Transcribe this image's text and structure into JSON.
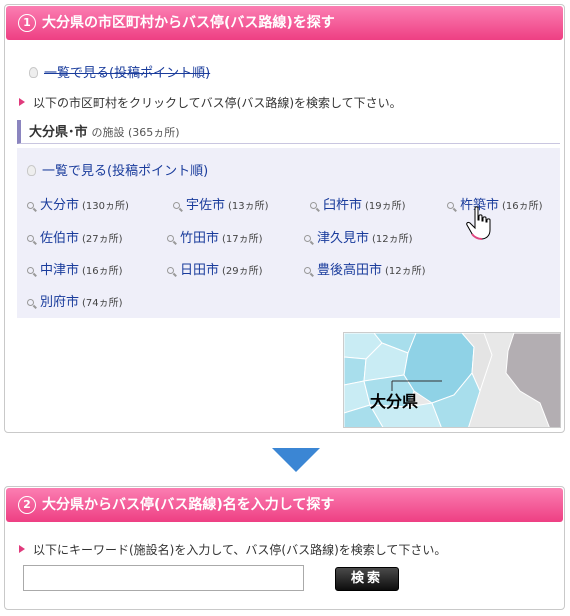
{
  "section1": {
    "number": "1",
    "title": "大分県の市区町村からバス停(バス路線)を探す",
    "list_link_top": "一覧で見る(投稿ポイント順)",
    "instruction": "以下の市区町村をクリックしてバス停(バス路線)を検索して下さい。",
    "prefecture_name": "大分県･市",
    "prefecture_count": "の施設 (365ヵ所)",
    "list_link": "一覧で見る(投稿ポイント順)",
    "cities": [
      {
        "name": "大分市",
        "count": "(130ヵ所)"
      },
      {
        "name": "宇佐市",
        "count": "(13ヵ所)"
      },
      {
        "name": "臼杵市",
        "count": "(19ヵ所)"
      },
      {
        "name": "杵築市",
        "count": "(16ヵ所)"
      },
      {
        "name": "佐伯市",
        "count": "(27ヵ所)"
      },
      {
        "name": "竹田市",
        "count": "(17ヵ所)"
      },
      {
        "name": "津久見市",
        "count": "(12ヵ所)"
      },
      {
        "name": "中津市",
        "count": "(16ヵ所)"
      },
      {
        "name": "日田市",
        "count": "(29ヵ所)"
      },
      {
        "name": "豊後高田市",
        "count": "(12ヵ所)"
      },
      {
        "name": "別府市",
        "count": "(74ヵ所)"
      }
    ],
    "map_label": "大分県"
  },
  "section2": {
    "number": "2",
    "title": "大分県からバス停(バス路線)名を入力して探す",
    "instruction": "以下にキーワード(施設名)を入力して、バス停(バス路線)を検索して下さい。",
    "input_value": "",
    "search_button": "検索"
  },
  "colors": {
    "header_pink": "#ee3f83",
    "link_blue": "#1a3c9c",
    "city_box_bg": "#efeff9",
    "arrow_blue": "#3b86d4",
    "map_highlight": "#8fd2e6"
  }
}
